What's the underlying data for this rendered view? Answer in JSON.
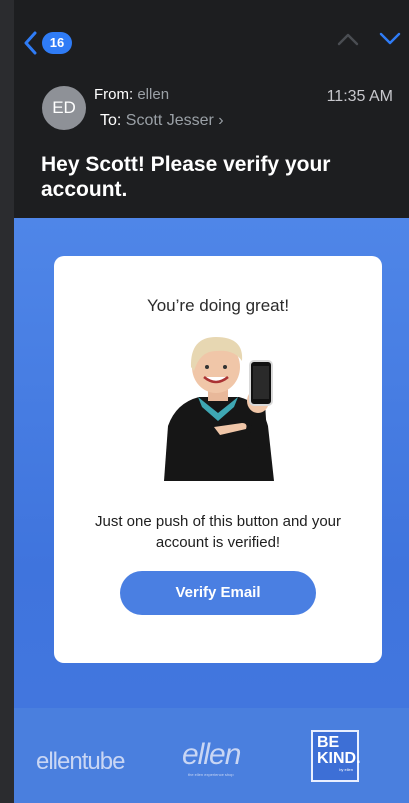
{
  "nav": {
    "badge_count": "16"
  },
  "header": {
    "avatar_initials": "ED",
    "from_label": "From:",
    "from_name": "ellen",
    "to_label": "To:",
    "to_name": "Scott Jesser",
    "time": "11:35 AM",
    "subject": "Hey Scott! Please verify your account."
  },
  "card": {
    "title": "You’re doing great!",
    "message": "Just one push of this button and your account is verified!",
    "button_label": "Verify Email"
  },
  "footer": {
    "logo1": "ellentube",
    "logo2": "ellen",
    "logo2_sub": "the ellen experience shop",
    "logo3_line1": "BE",
    "logo3_line2": "KIND.",
    "logo3_sub": "by ellen"
  },
  "colors": {
    "accent": "#2f7cf6",
    "mail_bg": "#4f86e8",
    "button": "#4a7fe2"
  }
}
